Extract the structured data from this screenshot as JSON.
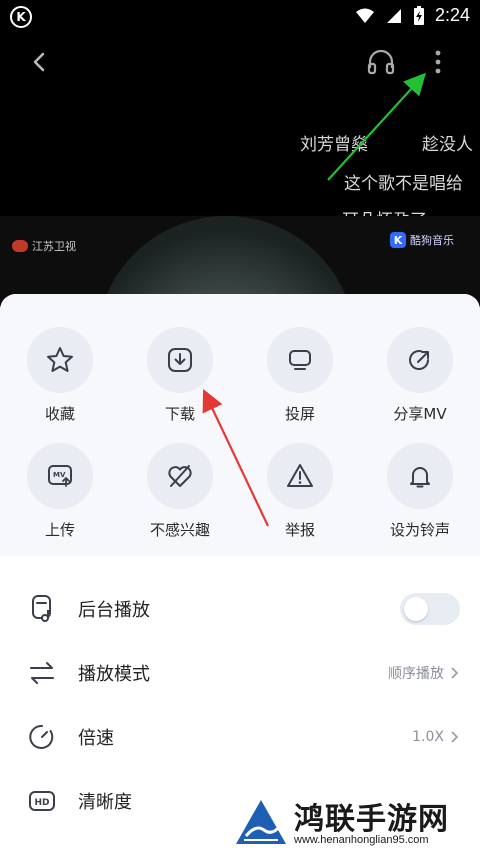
{
  "status_bar": {
    "logo_letter": "K",
    "time": "2:24"
  },
  "danmaku": [
    "刘芳曾燊",
    "趁没人",
    "这个歌不是唱给",
    "耳朵怀孕了"
  ],
  "video": {
    "logo_left": "江苏卫视",
    "logo_right_badge": "K",
    "logo_right": "酷狗音乐"
  },
  "actions": [
    {
      "label": "收藏",
      "icon": "star-icon"
    },
    {
      "label": "下载",
      "icon": "download-icon"
    },
    {
      "label": "投屏",
      "icon": "cast-screen-icon"
    },
    {
      "label": "分享MV",
      "icon": "share-icon"
    },
    {
      "label": "上传",
      "icon": "mv-upload-icon"
    },
    {
      "label": "不感兴趣",
      "icon": "not-interested-icon"
    },
    {
      "label": "举报",
      "icon": "warning-icon"
    },
    {
      "label": "设为铃声",
      "icon": "bell-icon"
    }
  ],
  "settings": [
    {
      "label": "后台播放",
      "icon": "background-play-icon",
      "toggle": false
    },
    {
      "label": "播放模式",
      "icon": "play-mode-icon",
      "value": "顺序播放"
    },
    {
      "label": "倍速",
      "icon": "speed-icon",
      "value": "1.0X"
    },
    {
      "label": "清晰度",
      "icon": "hd-icon"
    }
  ],
  "watermark": {
    "title": "鸿联手游网",
    "url": "www.henanhonglian95.com"
  },
  "colors": {
    "sheet_bg": "#f7f8fb",
    "circle_bg": "#e9ecf3",
    "arrow_green": "#22c033",
    "arrow_red": "#e53935"
  }
}
